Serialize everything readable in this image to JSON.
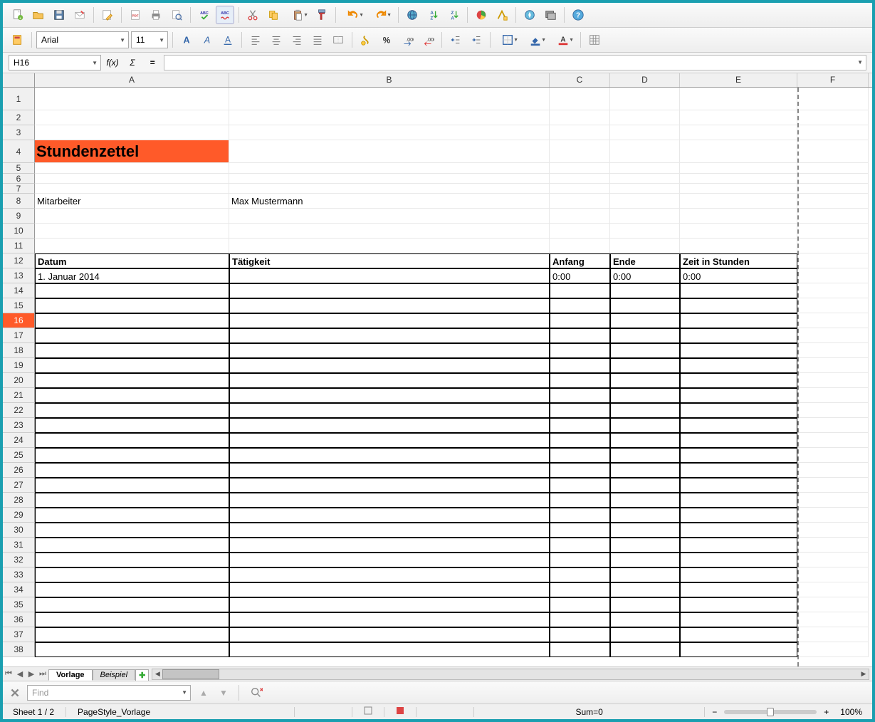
{
  "toolbar1": {
    "icons": [
      "new-doc",
      "open",
      "save",
      "email",
      "divider",
      "edit",
      "pdf-export",
      "print",
      "print-preview",
      "divider",
      "spellcheck",
      "auto-spellcheck",
      "divider",
      "cut",
      "copy",
      "paste",
      "format-paint",
      "divider",
      "undo",
      "redo",
      "divider",
      "hyperlink",
      "sort-asc",
      "sort-desc",
      "divider",
      "chart",
      "pivot",
      "divider",
      "navigator",
      "gallery",
      "divider",
      "help"
    ]
  },
  "toolbar2": {
    "style_icon": "cell-style",
    "font_name": "Arial",
    "font_size": "11",
    "items": [
      "bold",
      "italic",
      "underline",
      "divider",
      "align-left",
      "align-center",
      "align-right",
      "align-justify",
      "merge-cells",
      "divider",
      "currency",
      "percent",
      "decimal-add",
      "decimal-remove",
      "divider",
      "indent-dec",
      "indent-inc",
      "divider",
      "borders",
      "bg-color",
      "font-color",
      "divider",
      "grid-lines"
    ]
  },
  "formula_bar": {
    "cell_ref": "H16",
    "fx": "f(x)",
    "sigma": "Σ",
    "equals": "=",
    "input": ""
  },
  "columns": [
    "A",
    "B",
    "C",
    "D",
    "E",
    "F"
  ],
  "sheet": {
    "title": "Stundenzettel",
    "label_mitarbeiter": "Mitarbeiter",
    "value_mitarbeiter": "Max Mustermann",
    "headers": {
      "datum": "Datum",
      "taetigkeit": "Tätigkeit",
      "anfang": "Anfang",
      "ende": "Ende",
      "zeit": "Zeit in Stunden"
    },
    "row13": {
      "datum": "1. Januar 2014",
      "taetigkeit": "",
      "anfang": "0:00",
      "ende": "0:00",
      "zeit": "0:00"
    }
  },
  "selected_row": 16,
  "tabs": {
    "active": "Vorlage",
    "other": "Beispiel",
    "add": "+"
  },
  "find": {
    "placeholder": "Find"
  },
  "status": {
    "sheet": "Sheet 1 / 2",
    "pagestyle": "PageStyle_Vorlage",
    "sum": "Sum=0",
    "zoom": "100%"
  },
  "colors": {
    "accent": "#ff5a29",
    "frame": "#1a9fb0"
  }
}
